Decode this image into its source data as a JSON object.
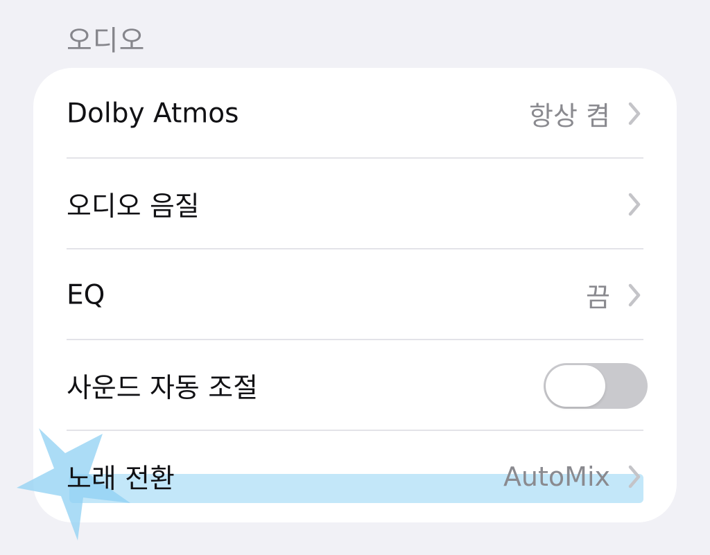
{
  "section": {
    "title": "오디오"
  },
  "rows": [
    {
      "label": "Dolby Atmos",
      "value": "항상 켬"
    },
    {
      "label": "오디오 음질",
      "value": ""
    },
    {
      "label": "EQ",
      "value": "끔"
    },
    {
      "label": "사운드 자동 조절",
      "toggle": false
    },
    {
      "label": "노래 전환",
      "value": "AutoMix"
    }
  ],
  "icons": {
    "chevron": "chevron-right-icon",
    "sticker": "star-sticker-icon"
  },
  "colors": {
    "background": "#f1f1f6",
    "card": "#ffffff",
    "secondary_text": "#8a8a8f",
    "toggle_off": "#c9c9cd",
    "highlight": "#b9e3f8",
    "sticker": "#8fd0f3"
  }
}
